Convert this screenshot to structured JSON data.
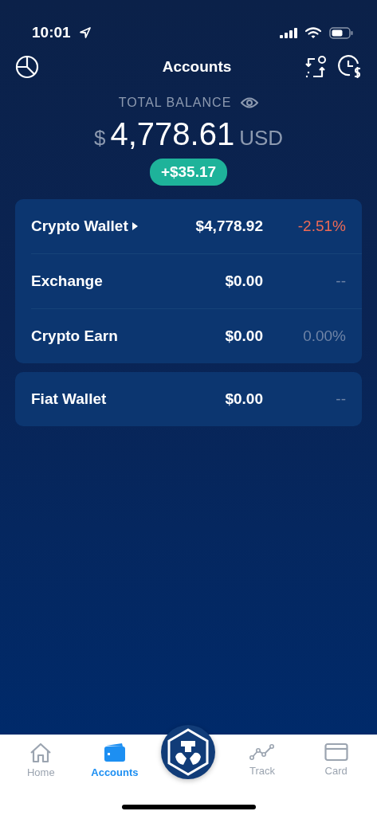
{
  "status_bar": {
    "time": "10:01"
  },
  "header": {
    "title": "Accounts"
  },
  "balance": {
    "label": "TOTAL BALANCE",
    "currency_symbol": "$",
    "amount": "4,778.61",
    "currency": "USD",
    "change": "+$35.17"
  },
  "account_groups": [
    {
      "accounts": [
        {
          "name": "Crypto Wallet",
          "expandable": true,
          "value": "$4,778.92",
          "change": "-2.51%",
          "color": "#ee6a55"
        },
        {
          "name": "Exchange",
          "expandable": false,
          "value": "$0.00",
          "change": "--",
          "color": "#6f84a6"
        },
        {
          "name": "Crypto Earn",
          "expandable": false,
          "value": "$0.00",
          "change": "0.00%",
          "color": "#6f84a6"
        }
      ]
    },
    {
      "accounts": [
        {
          "name": "Fiat Wallet",
          "expandable": false,
          "value": "$0.00",
          "change": "--",
          "color": "#6f84a6"
        }
      ]
    }
  ],
  "tab_bar": [
    {
      "kind": "tab",
      "label": "Home",
      "selected": false
    },
    {
      "kind": "tab",
      "label": "Accounts",
      "selected": true
    },
    {
      "kind": "center",
      "selected": false
    },
    {
      "kind": "tab",
      "label": "Track",
      "selected": false
    },
    {
      "kind": "tab",
      "label": "Card",
      "selected": false
    }
  ]
}
